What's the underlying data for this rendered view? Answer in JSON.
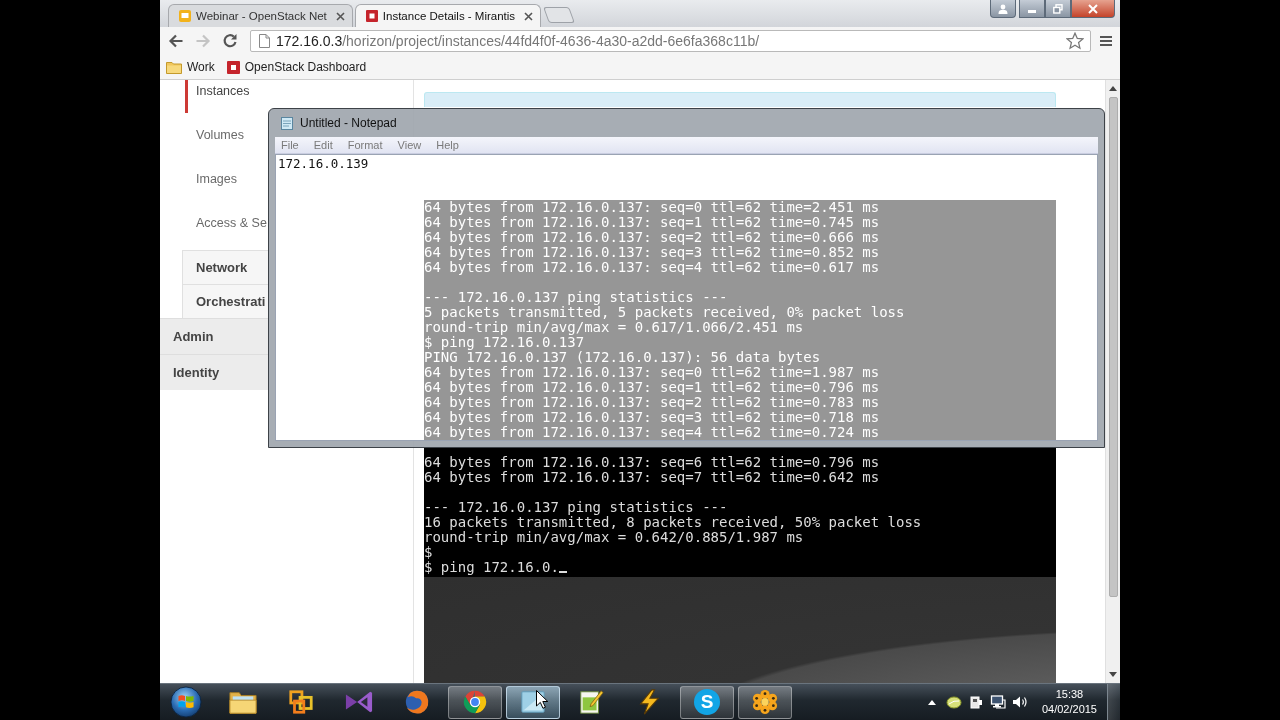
{
  "browser": {
    "tabs": [
      {
        "title": "Webinar - OpenStack Net",
        "kind": "slides",
        "selected": false
      },
      {
        "title": "Instance Details - Mirantis",
        "kind": "dashboard",
        "selected": true
      }
    ],
    "nav": [
      {
        "kind": "back",
        "disabled": false
      },
      {
        "kind": "forward",
        "disabled": true
      },
      {
        "kind": "reload",
        "disabled": false
      }
    ],
    "address": {
      "host": "172.16.0.3",
      "path": "/horizon/project/instances/44fd4f0f-4636-4a30-a2dd-6e6fa368c11b/"
    },
    "bookmarks": [
      {
        "label": "Work",
        "kind": "folder"
      },
      {
        "label": "OpenStack Dashboard",
        "kind": "site"
      }
    ]
  },
  "sidebar": {
    "items": [
      {
        "label": "Instances",
        "selected": true
      },
      {
        "label": "Volumes",
        "selected": false
      },
      {
        "label": "Images",
        "selected": false
      },
      {
        "label": "Access & Se",
        "selected": false
      }
    ],
    "sections": [
      {
        "label": "Network",
        "kind": "group"
      },
      {
        "label": "Orchestrati",
        "kind": "group"
      },
      {
        "label": "Admin",
        "kind": "dashboard"
      },
      {
        "label": "Identity",
        "kind": "dashboard"
      }
    ]
  },
  "console": {
    "seen_through_notepad": [
      [
        "64 bytes from 172.16.0.137: seq=0 ttl=62 time=2.451 ms",
        "64 bytes from 172.16.0.137: seq=1 ttl=62 time=0.745 ms",
        "64 bytes from 172.16.0.137: seq=2 ttl=62 time=0.666 ms",
        "64 bytes from 172.16.0.137: seq=3 ttl=62 time=0.852 ms",
        "64 bytes from 172.16.0.137: seq=4 ttl=62 time=0.617 ms"
      ],
      [
        "--- 172.16.0.137 ping statistics ---",
        "5 packets transmitted, 5 packets received, 0% packet loss",
        "round-trip min/avg/max = 0.617/1.066/2.451 ms",
        "$ ping 172.16.0.137",
        "PING 172.16.0.137 (172.16.0.137): 56 data bytes",
        "64 bytes from 172.16.0.137: seq=0 ttl=62 time=1.987 ms",
        "64 bytes from 172.16.0.137: seq=1 ttl=62 time=0.796 ms",
        "64 bytes from 172.16.0.137: seq=2 ttl=62 time=0.783 ms",
        "64 bytes from 172.16.0.137: seq=3 ttl=62 time=0.718 ms",
        "64 bytes from 172.16.0.137: seq=4 ttl=62 time=0.724 ms"
      ]
    ],
    "blocks": [
      [
        "64 bytes from 172.16.0.137: seq=6 ttl=62 time=0.796 ms",
        "64 bytes from 172.16.0.137: seq=7 ttl=62 time=0.642 ms"
      ],
      [
        "--- 172.16.0.137 ping statistics ---",
        "16 packets transmitted, 8 packets received, 50% packet loss",
        "round-trip min/avg/max = 0.642/0.885/1.987 ms",
        "$"
      ]
    ],
    "prompt": "$ ping 172.16.0.",
    "cursor": true
  },
  "notepad": {
    "title": "Untitled - Notepad",
    "menu": [
      "File",
      "Edit",
      "Format",
      "View",
      "Help"
    ],
    "text": "172.16.0.139"
  },
  "taskbar": {
    "apps": [
      {
        "kind": "folder",
        "running": false,
        "hovered": false
      },
      {
        "kind": "squares",
        "running": false,
        "hovered": false
      },
      {
        "kind": "bowtie",
        "running": false,
        "hovered": false
      },
      {
        "kind": "globe",
        "running": false,
        "hovered": false
      },
      {
        "kind": "wheel",
        "running": true,
        "hovered": false
      },
      {
        "kind": "pane",
        "running": true,
        "hovered": true
      },
      {
        "kind": "editor",
        "running": false,
        "hovered": false
      },
      {
        "kind": "bolt",
        "running": false,
        "hovered": false
      },
      {
        "kind": "chat",
        "glyph": "S",
        "running": true,
        "hovered": false
      },
      {
        "kind": "flower",
        "running": true,
        "hovered": false
      }
    ],
    "clock": {
      "time": "15:38",
      "date": "04/02/2015"
    }
  }
}
